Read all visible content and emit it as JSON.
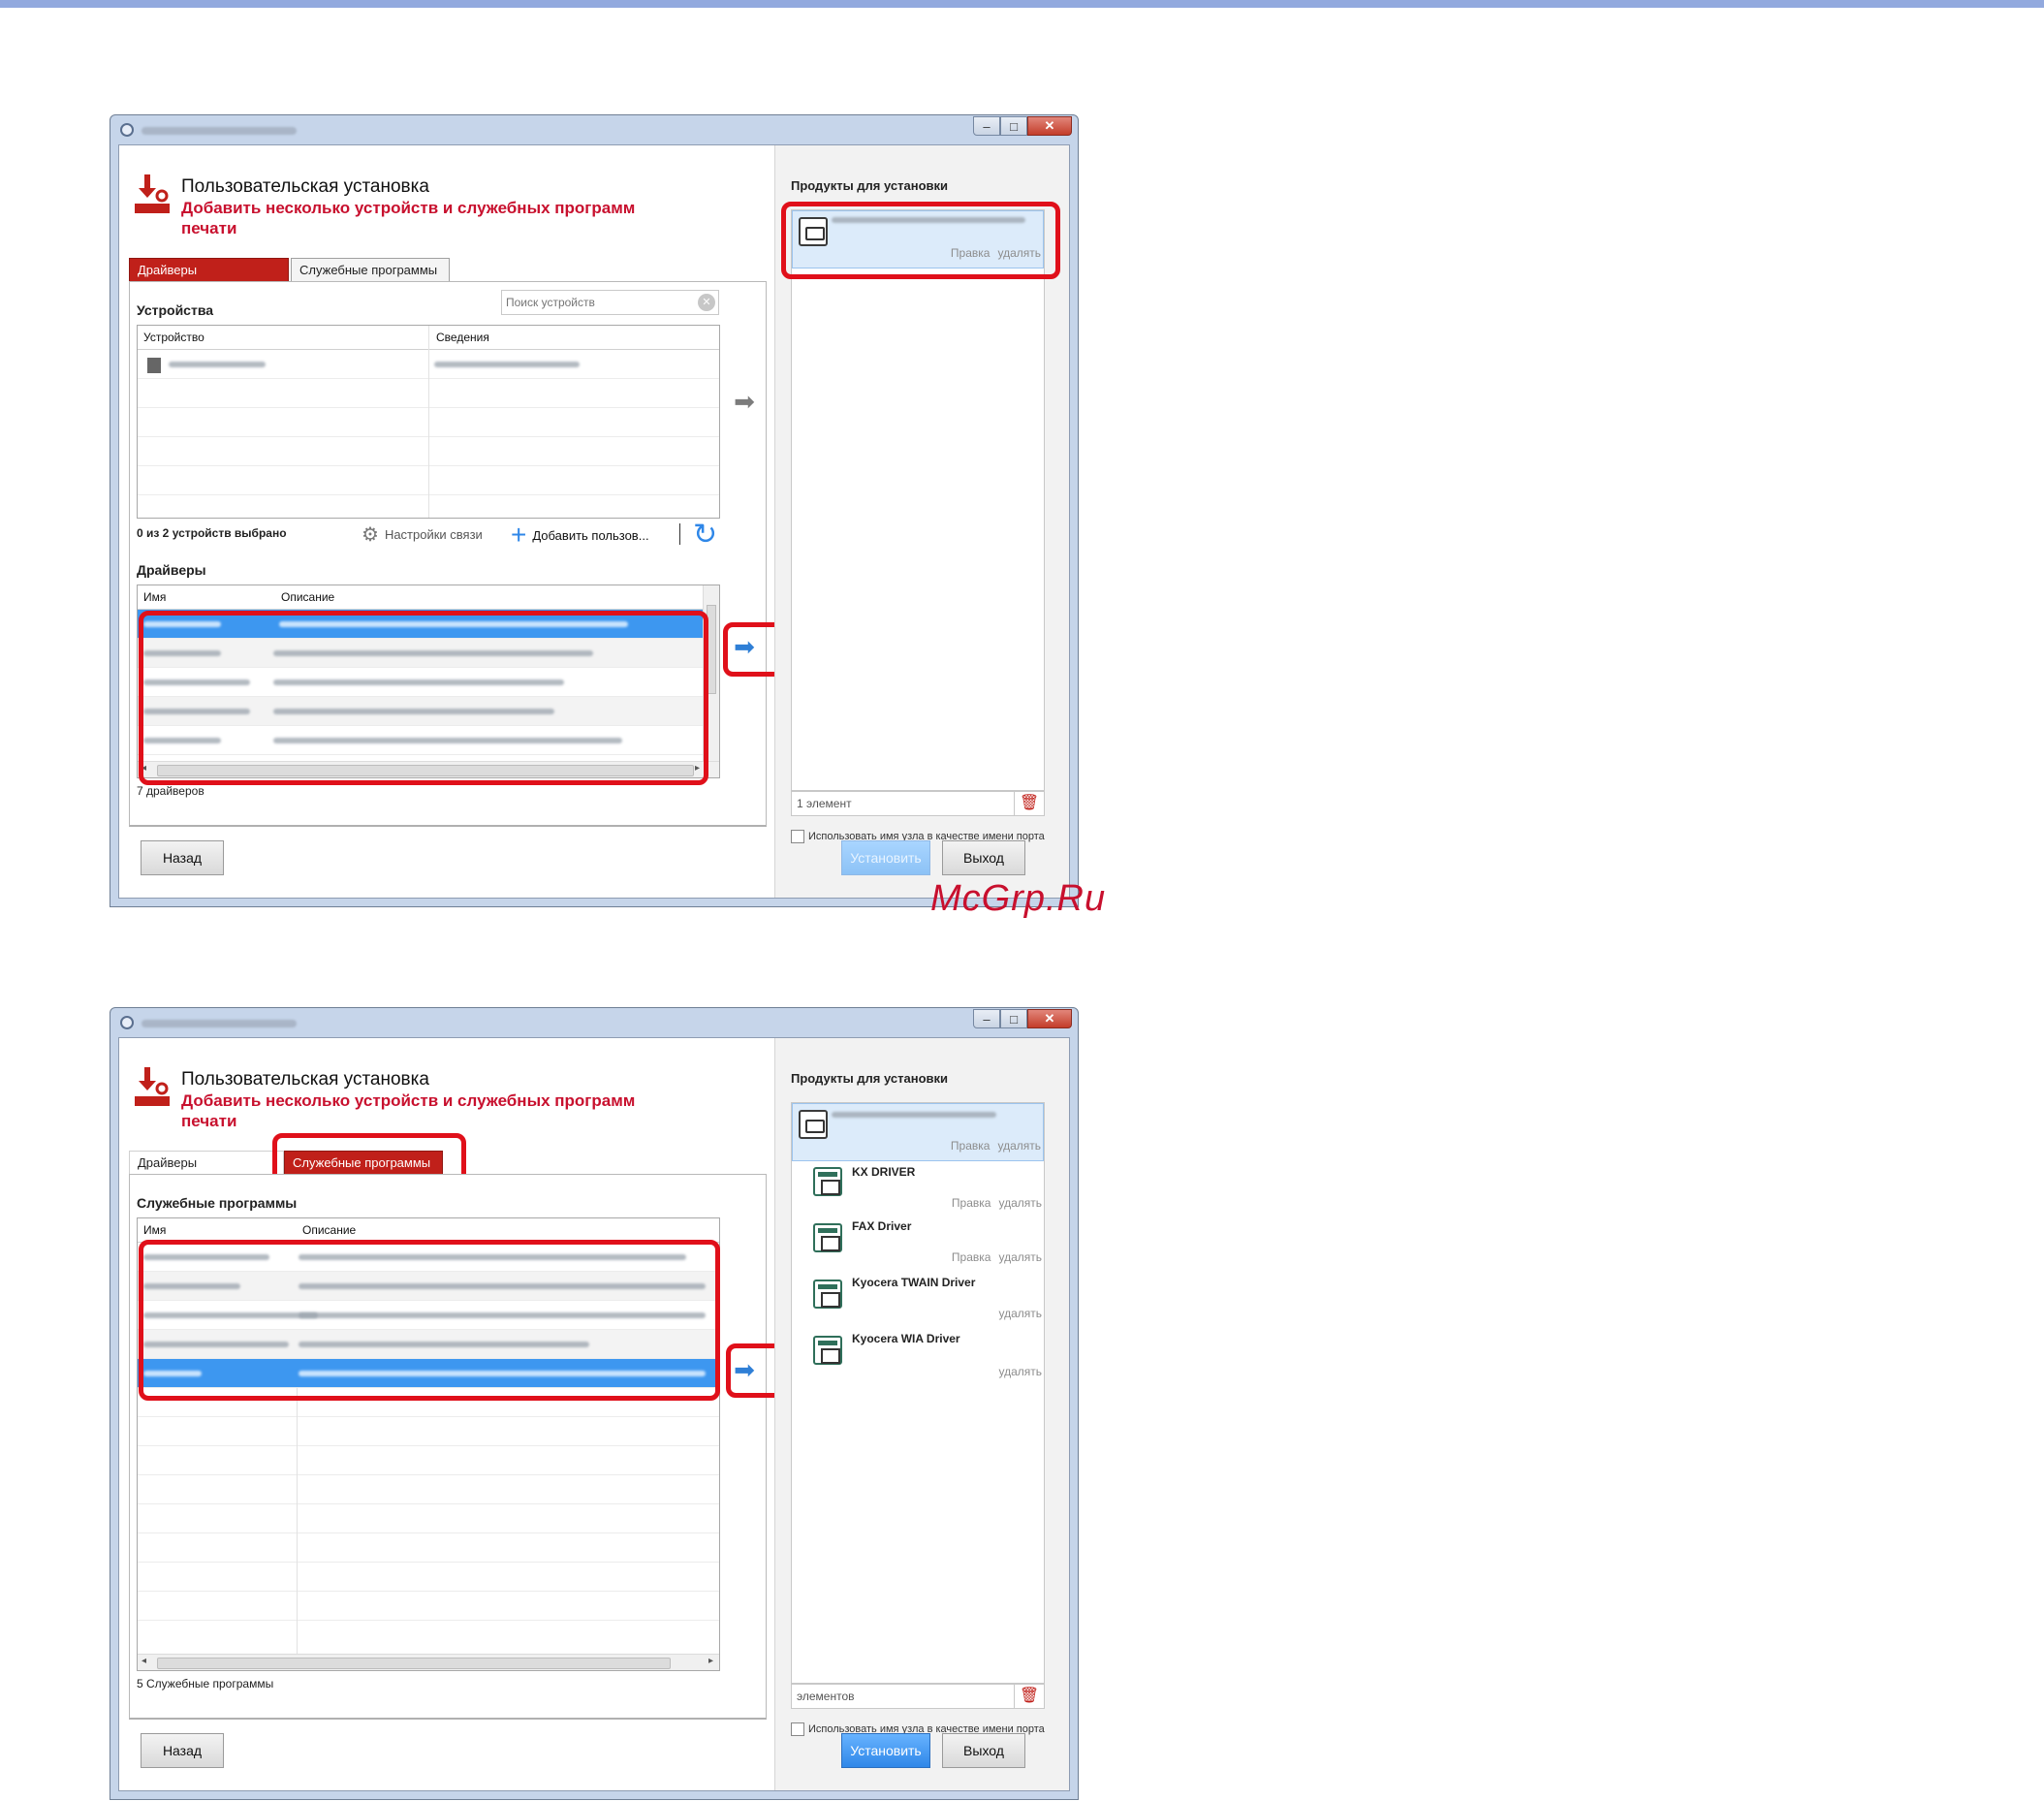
{
  "watermark": "McGrp.Ru",
  "header": {
    "title": "Пользовательская установка",
    "subtitle": "Добавить несколько устройств и служебных программ печати"
  },
  "tabs": {
    "drivers": "Драйверы",
    "utilities": "Служебные программы"
  },
  "window1": {
    "devices_label": "Устройства",
    "search_placeholder": "Поиск устройств",
    "device_columns": {
      "device": "Устройство",
      "details": "Сведения"
    },
    "devices_selected": "0 из 2 устройств выбрано",
    "comm_settings": "Настройки связи",
    "add_custom": "Добавить пользов...",
    "drivers_label": "Драйверы",
    "driver_columns": {
      "name": "Имя",
      "description": "Описание"
    },
    "drivers_count": "7 драйверов",
    "products_label": "Продукты для установки",
    "product_actions": {
      "help": "Правка",
      "remove": "удалять"
    },
    "element_count": "1 элемент",
    "hostname_checkbox": "Использовать имя узла в качестве имени порта",
    "back": "Назад",
    "install": "Установить",
    "exit": "Выход"
  },
  "window2": {
    "utilities_label": "Служебные программы",
    "columns": {
      "name": "Имя",
      "description": "Описание"
    },
    "utilities_count": "5 Служебные программы",
    "products_label": "Продукты для установки",
    "products": [
      {
        "name": "",
        "help": "Правка",
        "remove": "удалять"
      },
      {
        "name": "KX DRIVER",
        "help": "Правка",
        "remove": "удалять"
      },
      {
        "name": "FAX Driver",
        "help": "Правка",
        "remove": "удалять"
      },
      {
        "name": "Kyocera TWAIN Driver",
        "help": "",
        "remove": "удалять"
      },
      {
        "name": "Kyocera WIA Driver",
        "help": "",
        "remove": "удалять"
      }
    ],
    "element_count": "элементов",
    "hostname_checkbox": "Использовать имя узла в качестве имени порта",
    "back": "Назад",
    "install": "Установить",
    "exit": "Выход"
  },
  "icons": {
    "header": "download-gear-icon",
    "comm": "network-settings-icon",
    "add": "plus-icon",
    "refresh": "refresh-icon",
    "arrow": "arrow-right-icon",
    "trash": "trash-icon"
  },
  "colors": {
    "accent_red": "#c0201a",
    "highlight": "#e0101a",
    "selection": "#3d97f0",
    "primary_button": "#2f87e8"
  }
}
